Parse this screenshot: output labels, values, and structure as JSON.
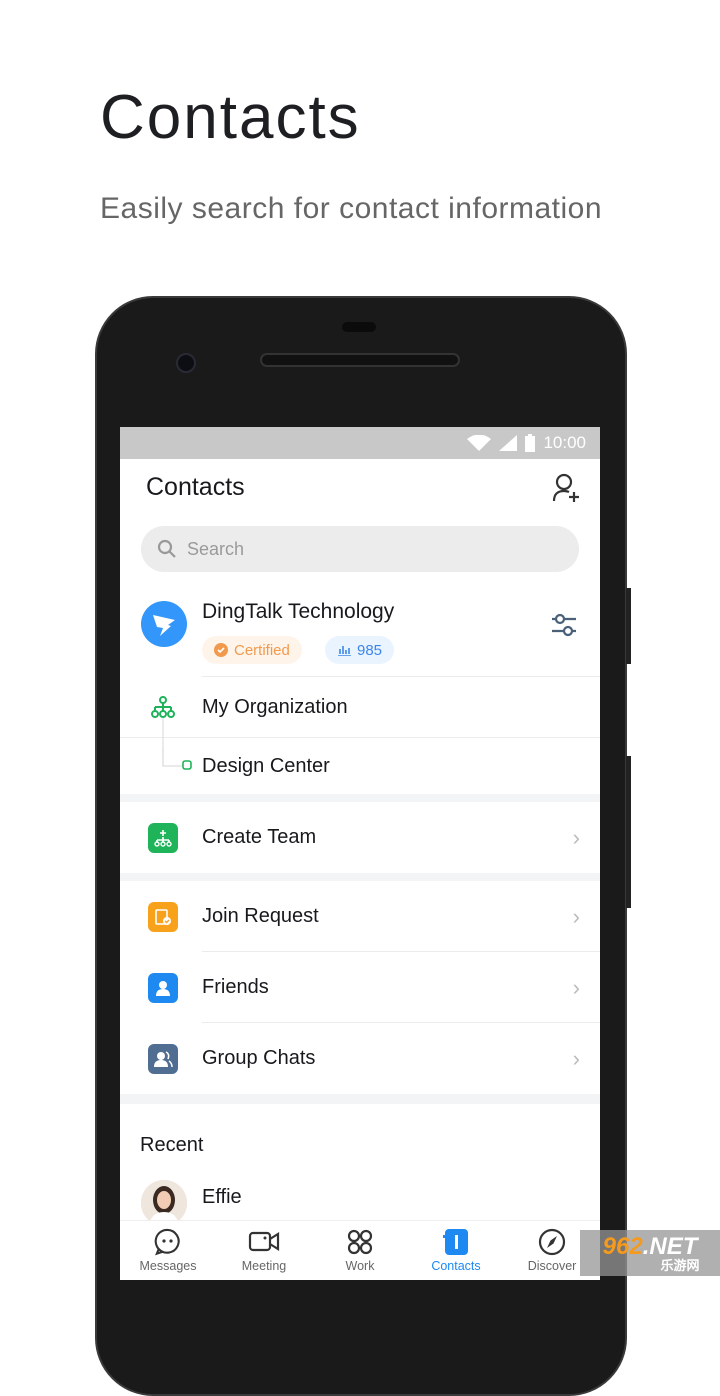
{
  "promo": {
    "title": "Contacts",
    "subtitle": "Easily search for contact information"
  },
  "status_bar": {
    "time": "10:00"
  },
  "header": {
    "title": "Contacts"
  },
  "search": {
    "placeholder": "Search"
  },
  "organization": {
    "name": "DingTalk Technology",
    "certified_label": "Certified",
    "member_count": "985",
    "brand_color": "#3296fa"
  },
  "org_tree": [
    {
      "label": "My Organization"
    },
    {
      "label": "Design Center"
    }
  ],
  "menu": [
    {
      "label": "Create Team",
      "icon": "create-team-icon",
      "color": "#1fb45a"
    },
    {
      "label": "Join Request",
      "icon": "join-request-icon",
      "color": "#f8a11a"
    },
    {
      "label": "Friends",
      "icon": "friends-icon",
      "color": "#1e89f0"
    },
    {
      "label": "Group Chats",
      "icon": "group-chats-icon",
      "color": "#4f6e92"
    }
  ],
  "recent": {
    "title": "Recent",
    "people": [
      {
        "name": "Effie"
      }
    ]
  },
  "tabs": [
    {
      "label": "Messages"
    },
    {
      "label": "Meeting"
    },
    {
      "label": "Work"
    },
    {
      "label": "Contacts",
      "active": true
    },
    {
      "label": "Discover"
    }
  ],
  "watermark": {
    "text": "962.NET 乐游网"
  }
}
